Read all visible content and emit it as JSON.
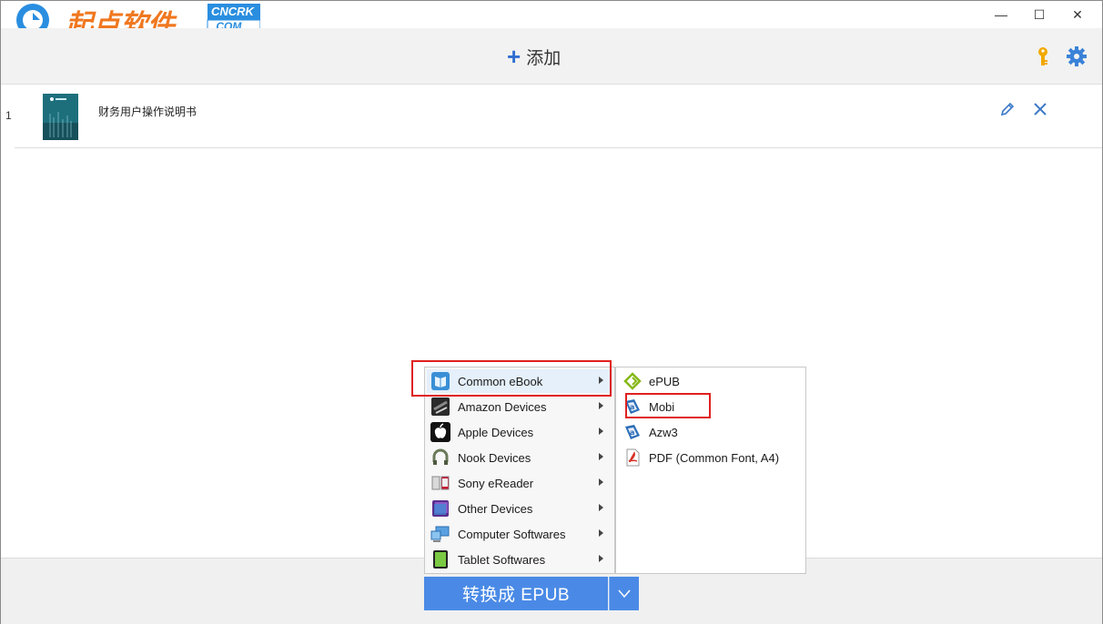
{
  "window": {
    "title": "",
    "minimize_glyph": "—",
    "maximize_glyph": "☐",
    "close_glyph": "✕"
  },
  "logo": {
    "brand_text": "起点软件",
    "badge_top": "CNCRK",
    "badge_bottom": ".COM"
  },
  "toolbar": {
    "add_label": "添加",
    "add_icon": "plus-icon",
    "key_icon": "key-icon",
    "settings_icon": "gear-icon"
  },
  "books": [
    {
      "index": "1",
      "title": "财务用户操作说明书"
    }
  ],
  "convert": {
    "button_label": "转换成 EPUB",
    "dropdown_glyph": "∨"
  },
  "format_menu": {
    "categories": [
      {
        "label": "Common eBook",
        "icon": "book-icon",
        "selected": true
      },
      {
        "label": "Amazon Devices",
        "icon": "kindle-icon",
        "selected": false
      },
      {
        "label": "Apple Devices",
        "icon": "apple-icon",
        "selected": false
      },
      {
        "label": "Nook Devices",
        "icon": "nook-icon",
        "selected": false
      },
      {
        "label": "Sony eReader",
        "icon": "sony-ereader-icon",
        "selected": false
      },
      {
        "label": "Other Devices",
        "icon": "device-icon",
        "selected": false
      },
      {
        "label": "Computer Softwares",
        "icon": "computer-icon",
        "selected": false
      },
      {
        "label": "Tablet Softwares",
        "icon": "tablet-icon",
        "selected": false
      }
    ],
    "submenu": [
      {
        "label": "ePUB",
        "icon": "epub-icon"
      },
      {
        "label": "Mobi",
        "icon": "mobi-icon"
      },
      {
        "label": "Azw3",
        "icon": "azw3-icon"
      },
      {
        "label": "PDF (Common Font, A4)",
        "icon": "pdf-icon"
      }
    ]
  },
  "colors": {
    "accent": "#4a8ae6",
    "highlight_box": "#e02020",
    "logo_orange": "#f07820",
    "logo_blue": "#2a8ee0"
  }
}
